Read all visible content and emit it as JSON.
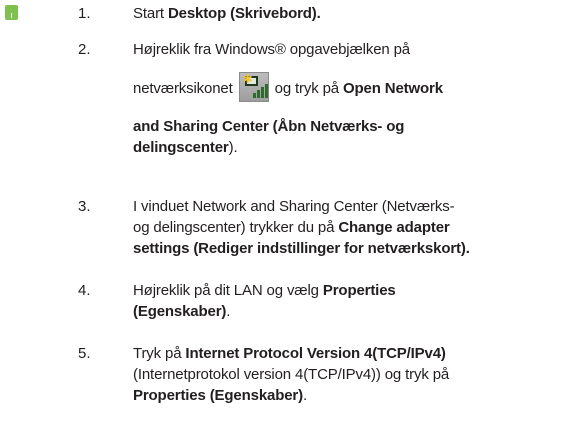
{
  "steps": [
    {
      "number": "1.",
      "lines": [
        [
          {
            "text": "Start "
          },
          {
            "text": "Desktop (Skrivebord).",
            "bold": true
          }
        ]
      ]
    },
    {
      "number": "2.",
      "line1": "Højreklik fra Windows® opgavebjælken på",
      "line2_before": "netværksikonet",
      "line2_after_plain": "og tryk på ",
      "line2_after_bold": "Open Network",
      "line3_bold": "and Sharing Center (Åbn Netværks- og",
      "line4_bold": "delingscenter",
      "line4_tail": ").",
      "icon": "network-tray-icon"
    },
    {
      "number": "3.",
      "line1": "I vinduet Network and Sharing Center (Netværks-",
      "line2_plain": "og delingscenter) trykker du på ",
      "line2_bold": "Change adapter",
      "line3_bold": "settings (Rediger indstillinger for netværkskort)."
    },
    {
      "number": "4.",
      "line1_plain": "Højreklik på dit LAN og vælg ",
      "line1_bold": "Properties",
      "line2_bold": "(Egenskaber)",
      "line2_tail": "."
    },
    {
      "number": "5.",
      "line1_plain": "Tryk på ",
      "line1_bold": "Internet Protocol Version 4(TCP/IPv4)",
      "line2_plain": "(Internetprotokol version 4(TCP/IPv4)) og tryk på",
      "line3_bold": "Properties (Egenskaber)",
      "line3_tail": "."
    }
  ],
  "colors": {
    "text": "#231f20",
    "marker": "#7fc04e"
  }
}
